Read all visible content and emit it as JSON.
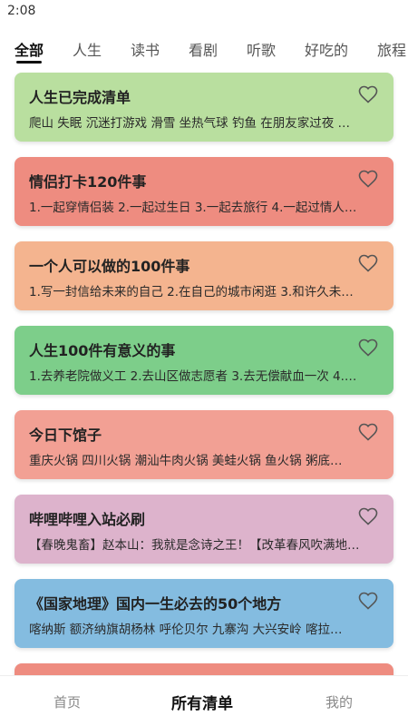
{
  "status": {
    "time": "2:08"
  },
  "tabs": [
    "全部",
    "人生",
    "读书",
    "看剧",
    "听歌",
    "好吃的",
    "旅程"
  ],
  "cards": [
    {
      "title": "人生已完成清单",
      "items": "爬山  失眠  沉迷打游戏  滑雪  坐热气球  钓鱼  在朋友家过夜 …",
      "color": "#b9df9f"
    },
    {
      "title": "情侣打卡120件事",
      "items": "1.一起穿情侣装  2.一起过生日  3.一起去旅行  4.一起过情人…",
      "color": "#ee8c80"
    },
    {
      "title": "一个人可以做的100件事",
      "items": "1.写一封信给未来的自己  2.在自己的城市闲逛  3.和许久未…",
      "color": "#f4b48f"
    },
    {
      "title": "人生100件有意义的事",
      "items": "1.去养老院做义工  2.去山区做志愿者  3.去无偿献血一次  4.…",
      "color": "#7dce8a"
    },
    {
      "title": "今日下馆子",
      "items": "重庆火锅  四川火锅  潮汕牛肉火锅  美蛙火锅  鱼火锅  粥底…",
      "color": "#f2a094"
    },
    {
      "title": "哔哩哔哩入站必刷",
      "items": "【春晚鬼畜】赵本山：我就是念诗之王！【改革春风吹满地…",
      "color": "#ddb3cc"
    },
    {
      "title": "《国家地理》国内一生必去的50个地方",
      "items": "喀纳斯  额济纳旗胡杨林  呼伦贝尔  九寨沟  大兴安岭  喀拉…",
      "color": "#84bce0"
    },
    {
      "title": "",
      "items": "",
      "color": "#ee8c80"
    }
  ],
  "bottom_nav": {
    "home": "首页",
    "all_lists": "所有清单",
    "mine": "我的"
  }
}
